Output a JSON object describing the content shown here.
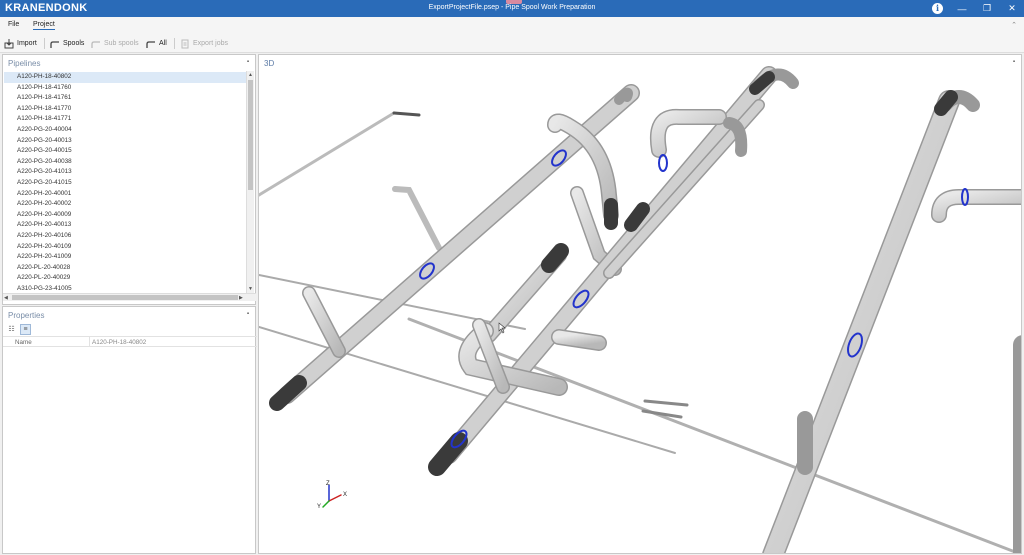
{
  "app": {
    "logo": "KRANENDONK",
    "window_title": "ExportProjectFile.psep - Pipe Spool Work Preparation",
    "info": "i",
    "minimize": "—",
    "restore": "❐",
    "close": "✕"
  },
  "menu": {
    "items": [
      {
        "label": "File"
      },
      {
        "label": "Project"
      }
    ],
    "collapse": "⌃"
  },
  "toolbar": {
    "import": "Import",
    "spools": "Spools",
    "sub_spools": "Sub spools",
    "all": "All",
    "export_jobs": "Export jobs"
  },
  "pipelines": {
    "title": "Pipelines",
    "pin": "▪",
    "items": [
      "A120-PH-18-40802",
      "A120-PH-18-41760",
      "A120-PH-18-41761",
      "A120-PH-18-41770",
      "A120-PH-18-41771",
      "A220-PG-20-40004",
      "A220-PG-20-40013",
      "A220-PG-20-40015",
      "A220-PG-20-40038",
      "A220-PG-20-41013",
      "A220-PG-20-41015",
      "A220-PH-20-40001",
      "A220-PH-20-40002",
      "A220-PH-20-40009",
      "A220-PH-20-40013",
      "A220-PH-20-40106",
      "A220-PH-20-40109",
      "A220-PH-20-41009",
      "A220-PL-20-40028",
      "A220-PL-20-40029",
      "A310-PG-23-41005"
    ]
  },
  "properties": {
    "title": "Properties",
    "pin": "▪",
    "name_label": "Name",
    "name_value": "A120-PH-18-40802"
  },
  "viewport": {
    "label": "3D",
    "pin": "▪",
    "axis_x": "X",
    "axis_y": "Y",
    "axis_z": "Z"
  },
  "colors": {
    "titlebar": "#2a6bb8",
    "pipe": "#c9c9c9",
    "flange_ring": "#2233cc",
    "end_cap": "#3a3a3a"
  }
}
